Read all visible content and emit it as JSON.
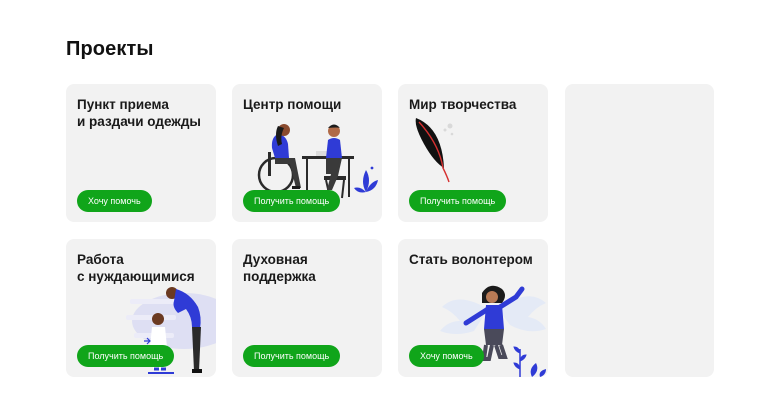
{
  "page": {
    "title": "Проекты"
  },
  "colors": {
    "button": "#10a51a",
    "card": "#f2f2f2",
    "accent_illustration": "#2f3bd6"
  },
  "cards": [
    {
      "title": "Пункт приема\nи раздачи одежды",
      "button": "Хочу помочь",
      "illustration": "none"
    },
    {
      "title": "Центр помощи",
      "button": "Получить помощь",
      "illustration": "wheelchair-conversation-illustration"
    },
    {
      "title": "Мир творчества",
      "button": "Получить помощь",
      "illustration": "feather-illustration"
    },
    {
      "title": "Работа\nс нуждающимися",
      "button": "Получить помощь",
      "illustration": "adult-helping-child-illustration"
    },
    {
      "title": "Духовная\nподдержка",
      "button": "Получить помощь",
      "illustration": "none"
    },
    {
      "title": "Стать волонтером",
      "button": "Хочу помочь",
      "illustration": "volunteer-angel-illustration"
    }
  ]
}
